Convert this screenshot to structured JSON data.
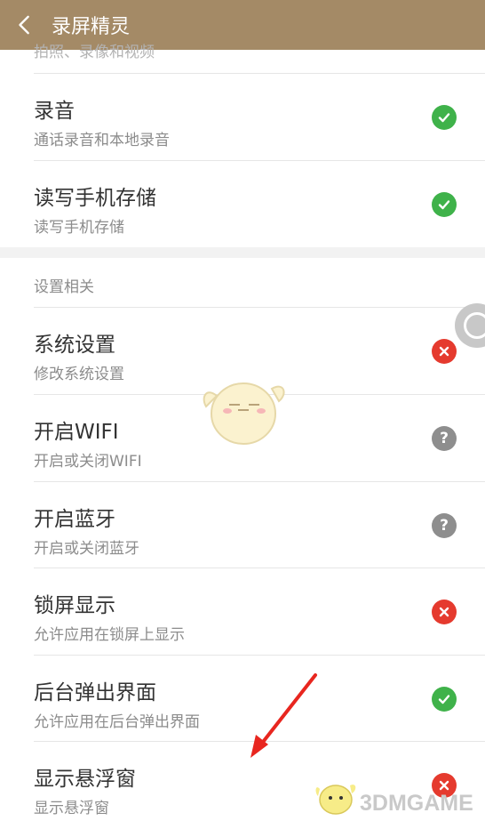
{
  "app": {
    "title": "录屏精灵"
  },
  "cut_text": "拍照、录像和视频",
  "permissions_top": [
    {
      "title": "录音",
      "subtitle": "通话录音和本地录音",
      "status": "granted"
    },
    {
      "title": "读写手机存储",
      "subtitle": "读写手机存储",
      "status": "granted"
    }
  ],
  "settings_section": {
    "header": "设置相关",
    "items": [
      {
        "title": "系统设置",
        "subtitle": "修改系统设置",
        "status": "denied"
      },
      {
        "title": "开启WIFI",
        "subtitle": "开启或关闭WIFI",
        "status": "unknown"
      },
      {
        "title": "开启蓝牙",
        "subtitle": "开启或关闭蓝牙",
        "status": "unknown"
      },
      {
        "title": "锁屏显示",
        "subtitle": "允许应用在锁屏上显示",
        "status": "denied"
      },
      {
        "title": "后台弹出界面",
        "subtitle": "允许应用在后台弹出界面",
        "status": "granted"
      },
      {
        "title": "显示悬浮窗",
        "subtitle": "显示悬浮窗",
        "status": "denied"
      }
    ]
  },
  "icons": {
    "back": "chevron-left-icon",
    "granted": "check-circle-icon",
    "denied": "x-circle-icon",
    "unknown": "question-circle-icon"
  },
  "colors": {
    "header_bg": "#a48a66",
    "granted": "#3fb24a",
    "denied": "#e53a2e",
    "unknown": "#8e8e8e",
    "arrow": "#e8261f"
  },
  "watermark": "3DMGAME"
}
